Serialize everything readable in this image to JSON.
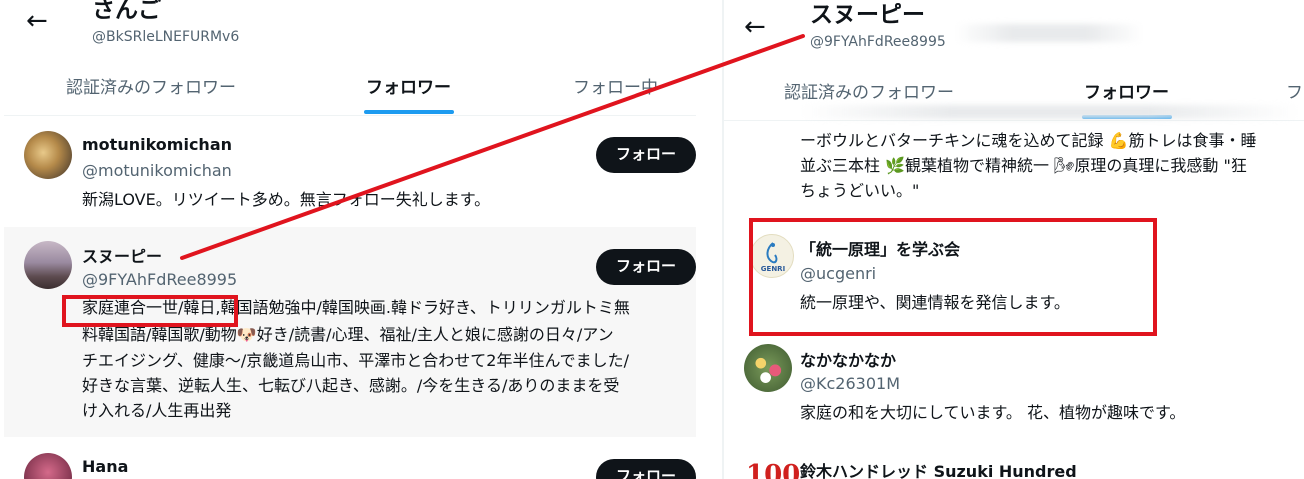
{
  "left": {
    "back_icon": "←",
    "title": "さんご",
    "handle": "@BkSRleLNEFURMv6",
    "tabs": [
      "認証済みのフォロワー",
      "フォロワー",
      "フォロー中"
    ],
    "users": [
      {
        "name": "motunikomichan",
        "handle": "@motunikomichan",
        "follow": "フォロー",
        "bio": [
          "新潟LOVE。リツイート多め。無言フォロー失礼します。"
        ]
      },
      {
        "name": "スヌーピー",
        "handle": "@9FYAhFdRee8995",
        "follow": "フォロー",
        "bio": [
          "家庭連合一世/韓日,韓国語勉強中/韓国映画.韓ドラ好き、トリリンガルトミ無",
          "料韓国語/韓国歌/動物🐶好き/読書/心理、福祉/主人と娘に感謝の日々/アン",
          "チエイジング、健康～/京畿道烏山市、平澤市と合わせて2年半住んでました/",
          "好きな言葉、逆転人生、七転び八起き、感謝。/今を生きる/ありのままを受",
          "け入れる/人生再出発"
        ]
      },
      {
        "name": "Hana",
        "follow": "フォロー"
      }
    ]
  },
  "right": {
    "back_icon": "←",
    "title": "スヌーピー",
    "handle": "@9FYAhFdRee8995",
    "tabs": [
      "認証済みのフォロワー",
      "フォロワー",
      "フ"
    ],
    "partial_bio": [
      "ーボウルとバターチキンに魂を込めて記録 💪筋トレは食事・睡",
      "並ぶ三本柱 🌿観葉植物で精神統一 🌬原理の真理に我感動 \"狂",
      "ちょうどいい。\""
    ],
    "users": [
      {
        "name": "「統一原理」を学ぶ会",
        "handle": "@ucgenri",
        "bio": "統一原理や、関連情報を発信します。",
        "avatar_text": "GENRI"
      },
      {
        "name": "なかなかなか",
        "handle": "@Kc26301M",
        "bio": "家庭の和を大切にしています。 花、植物が趣味です。"
      },
      {
        "name": "鈴木ハンドレッド Suzuki Hundred",
        "avatar_text": "100"
      }
    ]
  },
  "colors": {
    "accent": "#1d9bf0",
    "annotation": "#e0141e",
    "button": "#0f1419"
  }
}
